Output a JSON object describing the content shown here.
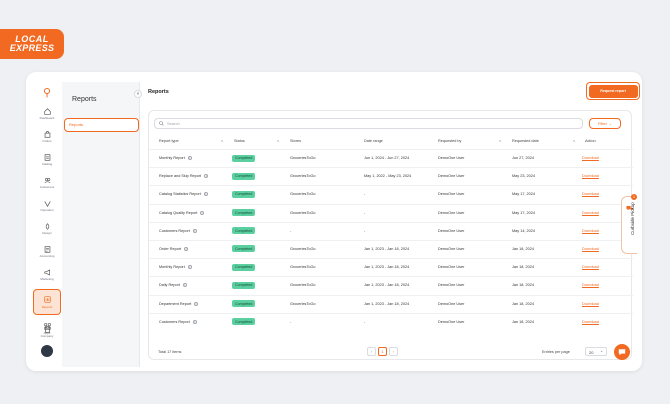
{
  "logo": {
    "line1": "LOCAL",
    "line2": "EXPRESS"
  },
  "sidebar": {
    "items": [
      {
        "label": "Dashboard",
        "icon": "home-icon"
      },
      {
        "label": "Orders",
        "icon": "bag-icon"
      },
      {
        "label": "Catalog",
        "icon": "catalog-icon"
      },
      {
        "label": "Customers",
        "icon": "customers-icon"
      },
      {
        "label": "Operation",
        "icon": "operation-icon"
      },
      {
        "label": "Design",
        "icon": "design-icon"
      },
      {
        "label": "Accounting",
        "icon": "accounting-icon"
      },
      {
        "label": "Marketing",
        "icon": "megaphone-icon"
      },
      {
        "label": "Reports",
        "icon": "reports-icon"
      },
      {
        "label": "Apps",
        "icon": "apps-icon"
      }
    ],
    "bottom_label": "Company"
  },
  "subpanel": {
    "title": "Reports",
    "selected_item": "Reports"
  },
  "page": {
    "title": "Reports",
    "request_button": "Request report"
  },
  "search": {
    "placeholder": "Search"
  },
  "filter": {
    "label": "Filter"
  },
  "table": {
    "columns": [
      "Report type",
      "Status",
      "Stores",
      "Date range",
      "Requested by",
      "Requested date",
      "Action"
    ],
    "rows": [
      {
        "type": "Monthly Report",
        "status": "Completed",
        "stores": "GroceriesToGo",
        "range": "Jun 1, 2024 - Jun 27, 2024",
        "by": "DemoOne User",
        "date": "Jun 27, 2024",
        "action": "Download"
      },
      {
        "type": "Replace and Skip Report",
        "status": "Completed",
        "stores": "GroceriesToGo",
        "range": "May 1, 2022 - May 23, 2024",
        "by": "DemoOne User",
        "date": "May 23, 2024",
        "action": "Download"
      },
      {
        "type": "Catalog Statistics Report",
        "status": "Completed",
        "stores": "GroceriesToGo",
        "range": "-",
        "by": "DemoOne User",
        "date": "May 17, 2024",
        "action": "Download"
      },
      {
        "type": "Catalog Quality Report",
        "status": "Completed",
        "stores": "GroceriesToGo",
        "range": "-",
        "by": "DemoOne User",
        "date": "May 17, 2024",
        "action": "Download"
      },
      {
        "type": "Customers Report",
        "status": "Completed",
        "stores": "-",
        "range": "-",
        "by": "DemoOne User",
        "date": "May 14, 2024",
        "action": "Download"
      },
      {
        "type": "Order Report",
        "status": "Completed",
        "stores": "GroceriesToGo",
        "range": "Jan 1, 2023 - Jan 18, 2024",
        "by": "DemoOne User",
        "date": "Jan 18, 2024",
        "action": "Download"
      },
      {
        "type": "Monthly Report",
        "status": "Completed",
        "stores": "GroceriesToGo",
        "range": "Jan 1, 2023 - Jan 18, 2024",
        "by": "DemoOne User",
        "date": "Jan 18, 2024",
        "action": "Download"
      },
      {
        "type": "Daily Report",
        "status": "Completed",
        "stores": "GroceriesToGo",
        "range": "Jan 1, 2023 - Jan 18, 2024",
        "by": "DemoOne User",
        "date": "Jan 18, 2024",
        "action": "Download"
      },
      {
        "type": "Department Report",
        "status": "Completed",
        "stores": "GroceriesToGo",
        "range": "Jan 1, 2023 - Jan 18, 2024",
        "by": "DemoOne User",
        "date": "Jan 18, 2024",
        "action": "Download"
      },
      {
        "type": "Customers Report",
        "status": "Completed",
        "stores": "-",
        "range": "-",
        "by": "DemoOne User",
        "date": "Jan 18, 2024",
        "action": "Download"
      }
    ]
  },
  "footer": {
    "total": "Total 17 items",
    "current_page": "1",
    "entries_label": "Entries per page",
    "entries_value": "20"
  },
  "side_tab": {
    "label": "Curbside Pickup",
    "count": "1"
  },
  "colors": {
    "accent": "#f26a21",
    "status_green": "#5ccfa0"
  }
}
